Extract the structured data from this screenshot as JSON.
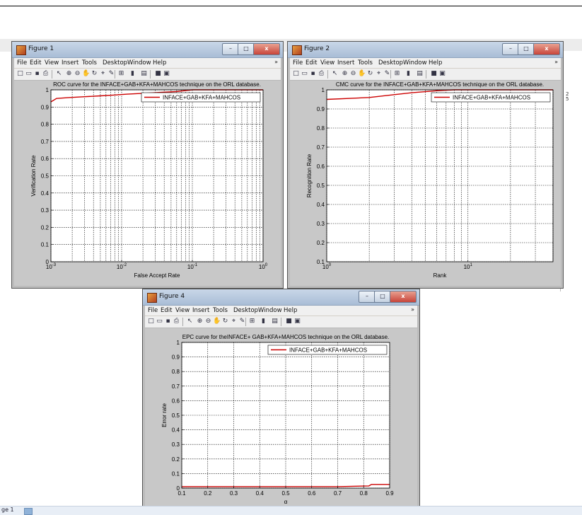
{
  "menu": {
    "items": [
      "File",
      "Edit",
      "View",
      "Insert",
      "Tools",
      "Desktop",
      "Window",
      "Help"
    ]
  },
  "toolbar": {
    "icons": [
      "new-icon",
      "open-icon",
      "save-icon",
      "print-icon",
      "pointer-icon",
      "zoom-in-icon",
      "zoom-out-icon",
      "pan-icon",
      "rotate-icon",
      "data-cursor-icon",
      "brush-icon",
      "link-icon",
      "colorbar-icon",
      "legend-icon",
      "hide-plot-tools-icon",
      "show-plot-tools-icon"
    ]
  },
  "window_buttons": {
    "minimize": "–",
    "maximize": "□",
    "close": "x"
  },
  "windows": [
    {
      "id": "fig1",
      "title": "Figure 1"
    },
    {
      "id": "fig2",
      "title": "Figure 2"
    },
    {
      "id": "fig4",
      "title": "Figure 4"
    }
  ],
  "status": {
    "page_label": "ge 1"
  },
  "chart_data": [
    {
      "type": "line",
      "title": "ROC curve for the INFACE+GAB+KFA+MAHCOS technique on the ORL database.",
      "xlabel": "False Accept Rate",
      "ylabel": "Verification Rate",
      "xscale": "log",
      "xlim": [
        0.001,
        1
      ],
      "ylim": [
        0,
        1
      ],
      "xticks": [
        "10-3",
        "10-2",
        "10-1",
        "100"
      ],
      "yticks": [
        "0",
        "0.1",
        "0.2",
        "0.3",
        "0.4",
        "0.5",
        "0.6",
        "0.7",
        "0.8",
        "0.9",
        "1"
      ],
      "grid": true,
      "legend_position": "top-right",
      "series": [
        {
          "name": "INFACE+GAB+KFA+MAHCOS",
          "color": "#cc0000",
          "x": [
            0.001,
            0.0012,
            0.0018,
            0.003,
            0.005,
            0.008,
            0.012,
            0.02,
            0.035,
            0.06,
            0.1,
            0.3,
            1
          ],
          "y": [
            0.93,
            0.95,
            0.955,
            0.96,
            0.965,
            0.97,
            0.975,
            0.98,
            0.985,
            0.99,
            1.0,
            1.0,
            1.0
          ]
        }
      ]
    },
    {
      "type": "line",
      "title": "CMC curve for the INFACE+GAB+KFA+MAHCOS technique on the ORL database.",
      "xlabel": "Rank",
      "ylabel": "Recognition Rate",
      "xscale": "log",
      "xlim": [
        1,
        40
      ],
      "ylim": [
        0.1,
        1
      ],
      "xticks": [
        "100",
        "101"
      ],
      "yticks": [
        "0.1",
        "0.2",
        "0.3",
        "0.4",
        "0.5",
        "0.6",
        "0.7",
        "0.8",
        "0.9",
        "1"
      ],
      "grid": true,
      "legend_position": "top-right",
      "series": [
        {
          "name": "INFACE+GAB+KFA+MAHCOS",
          "color": "#cc0000",
          "x": [
            1,
            2,
            3,
            4,
            6,
            8,
            40
          ],
          "y": [
            0.95,
            0.96,
            0.975,
            0.985,
            0.995,
            1.0,
            1.0
          ]
        }
      ]
    },
    {
      "type": "line",
      "title": "EPC curve for theINFACE+ GAB+KFA+MAHCOS technique on the ORL database.",
      "xlabel": "α",
      "ylabel": "Error rate",
      "xlim": [
        0.1,
        0.9
      ],
      "ylim": [
        0,
        1
      ],
      "xticks": [
        "0.1",
        "0.2",
        "0.3",
        "0.4",
        "0.5",
        "0.6",
        "0.7",
        "0.8",
        "0.9"
      ],
      "yticks": [
        "0",
        "0.1",
        "0.2",
        "0.3",
        "0.4",
        "0.5",
        "0.6",
        "0.7",
        "0.8",
        "0.9",
        "1"
      ],
      "grid": true,
      "legend_position": "top-right",
      "series": [
        {
          "name": "INFACE+GAB+KFA+MAHCOS",
          "color": "#cc0000",
          "x": [
            0.1,
            0.3,
            0.5,
            0.6,
            0.7,
            0.82,
            0.83,
            0.9
          ],
          "y": [
            0.01,
            0.01,
            0.01,
            0.01,
            0.01,
            0.015,
            0.025,
            0.025
          ]
        }
      ]
    }
  ]
}
